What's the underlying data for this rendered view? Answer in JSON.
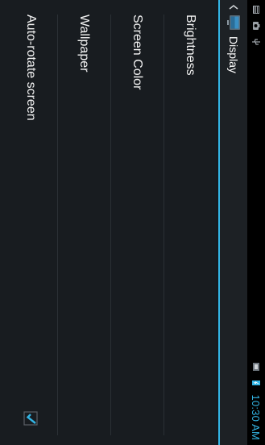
{
  "status_bar": {
    "time": "10:30 AM",
    "left_icons": [
      "notification-icon",
      "camera-icon",
      "usb-icon"
    ],
    "right_icons": [
      "signal-icon",
      "battery-icon"
    ]
  },
  "action_bar": {
    "title": "Display",
    "accent_color": "#33b5e5"
  },
  "settings": {
    "items": [
      {
        "label": "Brightness"
      },
      {
        "label": "Screen Color"
      },
      {
        "label": "Wallpaper"
      },
      {
        "label": "Auto-rotate screen",
        "checked": true
      }
    ]
  }
}
